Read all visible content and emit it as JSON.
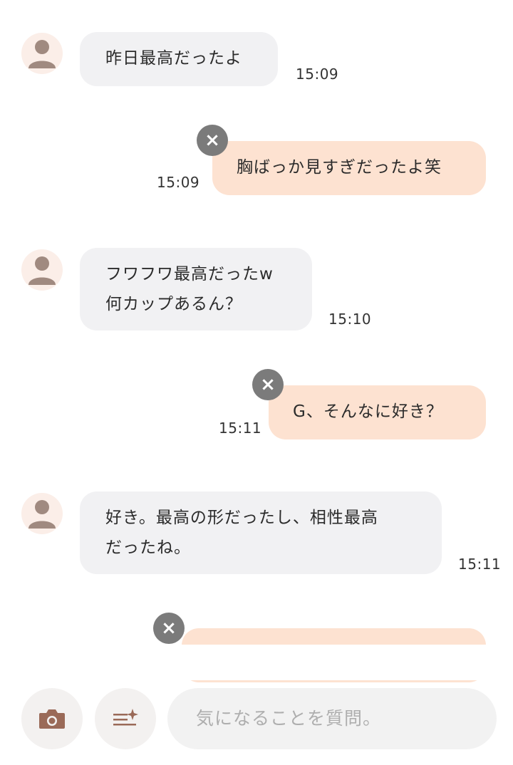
{
  "messages": [
    {
      "direction": "in",
      "text": "昨日最高だったよ",
      "time": "15:09"
    },
    {
      "direction": "out",
      "text": "胸ばっか見すぎだったよ笑",
      "time": "15:09",
      "delete_icon": "close-icon"
    },
    {
      "direction": "in",
      "text": "フワフワ最高だったw\n何カップあるん？",
      "time": "15:10"
    },
    {
      "direction": "out",
      "text": "G、そんなに好き？",
      "time": "15:11",
      "delete_icon": "close-icon"
    },
    {
      "direction": "in",
      "text": "好き。最高の形だったし、相性最高\nだったね。",
      "time": "15:11"
    },
    {
      "direction": "out",
      "text": "",
      "time": "",
      "delete_icon": "close-icon"
    }
  ],
  "input_bar": {
    "camera_icon": "camera-icon",
    "suggest_icon": "sparkle-list-icon",
    "placeholder": "気になることを質問。"
  },
  "colors": {
    "incoming_bubble": "#f1f1f3",
    "outgoing_bubble": "#fde2d1",
    "delete_badge": "#7b7b7b",
    "icon_brown": "#9a6a58"
  }
}
